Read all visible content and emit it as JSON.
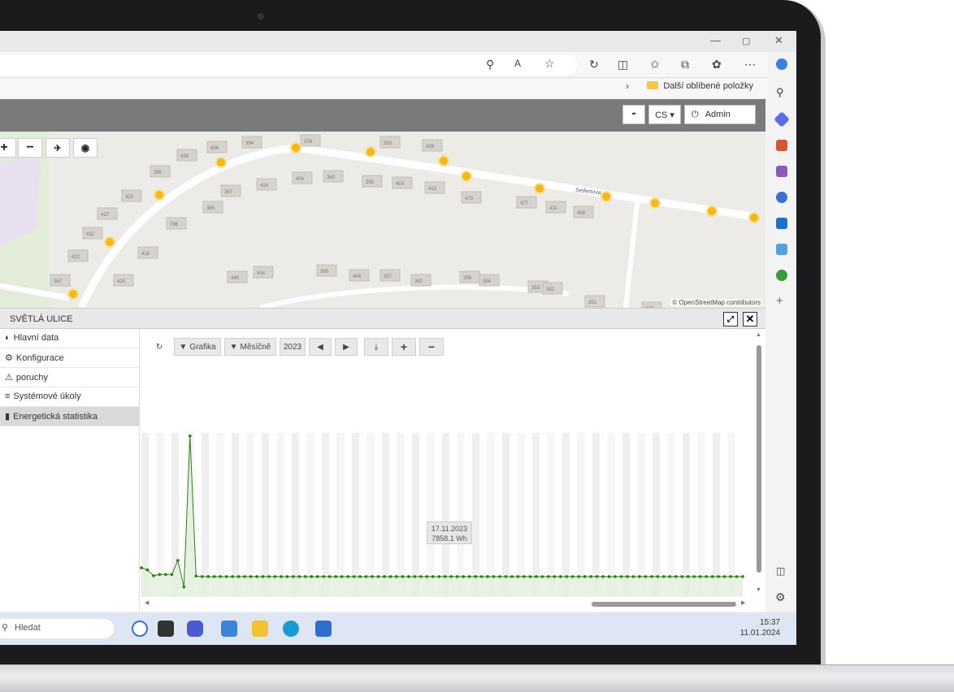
{
  "browser": {
    "favorites_folder": "Další oblíbené položky"
  },
  "header": {
    "language": "CS ▾",
    "user": "Admin"
  },
  "map": {
    "attribution": "© OpenStreetMap contributors",
    "street_name": "Seifertova",
    "house_numbers": [
      "394",
      "376",
      "353",
      "429",
      "436",
      "436",
      "395",
      "404",
      "360",
      "355",
      "403",
      "413",
      "387",
      "414",
      "473",
      "477",
      "411",
      "408",
      "385",
      "417",
      "420",
      "796",
      "432",
      "422",
      "418",
      "367",
      "425",
      "445",
      "414",
      "399",
      "406",
      "357",
      "362",
      "356",
      "354",
      "353",
      "352",
      "351",
      "397"
    ]
  },
  "panel": {
    "title": "SVĚTLÁ ULICE"
  },
  "menu": {
    "items": [
      {
        "icon": "◐",
        "label": "Hlavní data"
      },
      {
        "icon": "⚙",
        "label": "Konfigurace"
      },
      {
        "icon": "⚠",
        "label": "poruchy"
      },
      {
        "icon": "≡",
        "label": "Systémové úkoly"
      },
      {
        "icon": "▮",
        "label": "Energetická statistika"
      }
    ],
    "selected_index": 4
  },
  "chart_toolbar": {
    "graph_label": "Grafika",
    "monthly_label": "Měsíčně",
    "year": "2023"
  },
  "chart_data": {
    "type": "line",
    "title": "",
    "xlabel": "",
    "ylabel": "",
    "x_count": 100,
    "values": [
      960,
      890,
      700,
      740,
      740,
      740,
      1200,
      330,
      5300,
      690,
      670,
      670,
      670,
      670,
      670,
      670,
      670,
      670,
      670,
      670,
      670,
      670,
      670,
      670,
      670,
      670,
      670,
      670,
      670,
      670,
      670,
      670,
      670,
      670,
      670,
      670,
      670,
      670,
      670,
      670,
      670,
      670,
      670,
      670,
      670,
      670,
      670,
      670,
      670,
      670,
      670,
      670,
      670,
      670,
      670,
      670,
      670,
      670,
      670,
      670,
      670,
      670,
      670,
      670,
      670,
      670,
      670,
      670,
      670,
      670,
      670,
      670,
      670,
      670,
      670,
      670,
      670,
      670,
      670,
      670,
      670,
      670,
      670,
      670,
      670,
      670,
      670,
      670,
      670,
      670,
      670,
      670,
      670,
      670,
      670,
      670,
      670,
      670,
      670,
      670
    ],
    "highlight": {
      "date": "17.11.2023",
      "value": "7858.1 Wh"
    },
    "color": "#2e7d1a",
    "fill": "#e3f0dc"
  },
  "taskbar": {
    "search_placeholder": "Hledat",
    "time": "15:37",
    "date": "11.01.2024"
  }
}
